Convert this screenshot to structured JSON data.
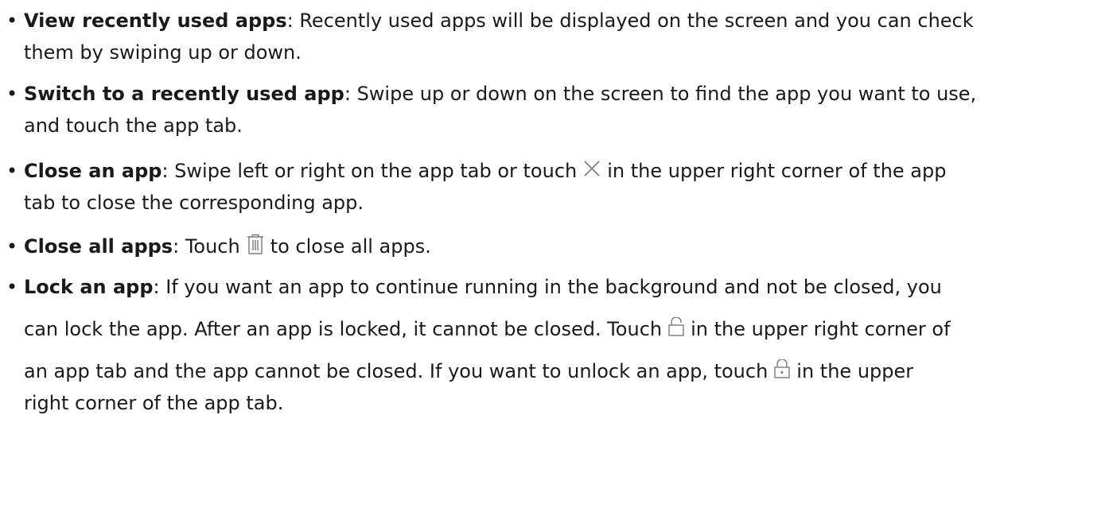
{
  "items": [
    {
      "term": "View recently used apps",
      "sep": ":",
      "line1": " Recently used apps will be displayed on the screen and you can check",
      "line2": "them by swiping up or down."
    },
    {
      "term": "Switch to a recently used app",
      "sep": ":",
      "line1": " Swipe up or down on the screen to find the app you want to use,",
      "line2": "and touch the app tab."
    },
    {
      "term": "Close an app",
      "sep": ":",
      "line1_before": " Swipe left or right on the app tab or touch",
      "line1_after": "in the upper right corner of the app",
      "line2": "tab to close the corresponding app."
    },
    {
      "term": "Close all apps",
      "sep": ":",
      "line1_before": " Touch",
      "line1_after": "to close all apps."
    },
    {
      "term": "Lock an app",
      "sep": ":",
      "line1": " If you want an app to continue running in the background and not be closed, you",
      "line2_before": "can lock the app. After an app is locked, it cannot be closed. Touch",
      "line2_after": "in the upper right corner of",
      "line3_before": "an app tab and the app cannot be closed. If you want to unlock an app, touch",
      "line3_after": "in the upper",
      "line4": "right corner of the app tab."
    }
  ],
  "icons": [
    "close-x-icon",
    "trash-icon",
    "unlocked-padlock-icon",
    "locked-padlock-icon"
  ],
  "colors": {
    "text": "#1a1a1a",
    "icon": "#7a7a7a"
  }
}
